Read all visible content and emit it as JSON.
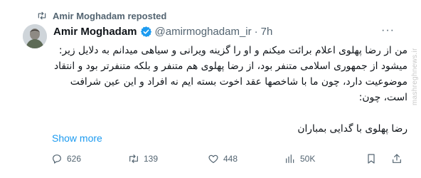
{
  "repost": {
    "text": "Amir Moghadam reposted"
  },
  "author": {
    "name": "Amir Moghadam",
    "handle": "@amirmoghadam_ir",
    "separator": "·",
    "time": "7h"
  },
  "more_label": "···",
  "body": {
    "paragraph1": "من از رضا پهلوی اعلام برائت میکنم و او را گزینه ویرانی و سیاهی میدانم به دلایل زیر: میشود از جمهوری اسلامی متنفر بود، از رضا پهلوی هم متنفر و بلکه متنفرتر بود و انتقاد موضوعیت دارد، چون ما با شاخصها عقد اخوت بسته ایم نه افراد و این عین شرافت است، چون:",
    "paragraph2": "رضا پهلوی با گدایی بمباران"
  },
  "watermark": "mashreghnews.ir",
  "show_more": "Show more",
  "actions": {
    "replies": "626",
    "reposts": "139",
    "likes": "448",
    "views": "50K"
  },
  "icons": {
    "repost": "repost-icon",
    "verified": "verified-badge-icon",
    "more": "more-icon",
    "reply": "reply-icon",
    "like": "heart-icon",
    "views": "views-icon",
    "bookmark": "bookmark-icon",
    "share": "share-icon"
  },
  "colors": {
    "accent": "#1d9bf0",
    "text": "#0f1419",
    "secondary": "#536471"
  }
}
